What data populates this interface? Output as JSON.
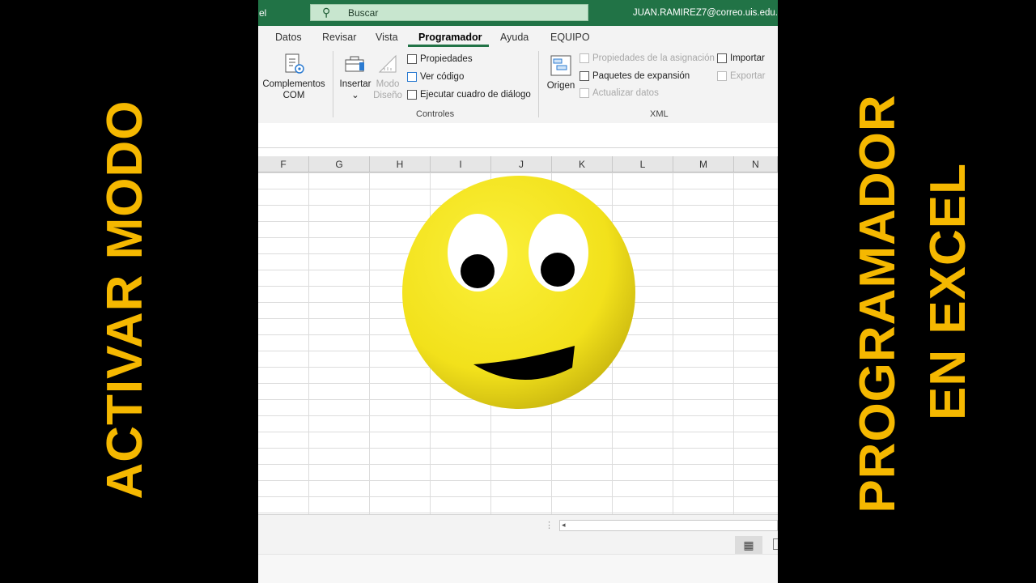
{
  "overlay": {
    "left": "ACTIVAR MODO",
    "right_line1": "PROGRAMADOR",
    "right_line2": "EN EXCEL"
  },
  "titlebar": {
    "app_fragment": "el",
    "search_placeholder": "Buscar",
    "user": "JUAN.RAMIREZ7@correo.uis.edu."
  },
  "tabs": [
    {
      "label": "Datos"
    },
    {
      "label": "Revisar"
    },
    {
      "label": "Vista"
    },
    {
      "label": "Programador",
      "active": true
    },
    {
      "label": "Ayuda"
    },
    {
      "label": "EQUIPO"
    }
  ],
  "ribbon": {
    "complementos": {
      "line1": "Complementos",
      "line2": "COM"
    },
    "insertar": {
      "label": "Insertar",
      "arrow": "⌄"
    },
    "modo": {
      "line1": "Modo",
      "line2": "Diseño"
    },
    "propiedades": "Propiedades",
    "ver_codigo": "Ver código",
    "ejecutar": "Ejecutar cuadro de diálogo",
    "controles_label": "Controles",
    "origen": "Origen",
    "prop_asignacion": "Propiedades de la asignación",
    "paquetes": "Paquetes de expansión",
    "actualizar": "Actualizar datos",
    "importar": "Importar",
    "exportar": "Exportar",
    "xml_label": "XML"
  },
  "columns": [
    "F",
    "G",
    "H",
    "I",
    "J",
    "K",
    "L",
    "M",
    "N"
  ],
  "statusbar": {
    "dots": "⋮",
    "left_arrow": "◂"
  },
  "view_icon": "▦",
  "colors": {
    "excel_green": "#217346",
    "overlay_text": "#f5b800",
    "smiley": "#f3e21e"
  }
}
